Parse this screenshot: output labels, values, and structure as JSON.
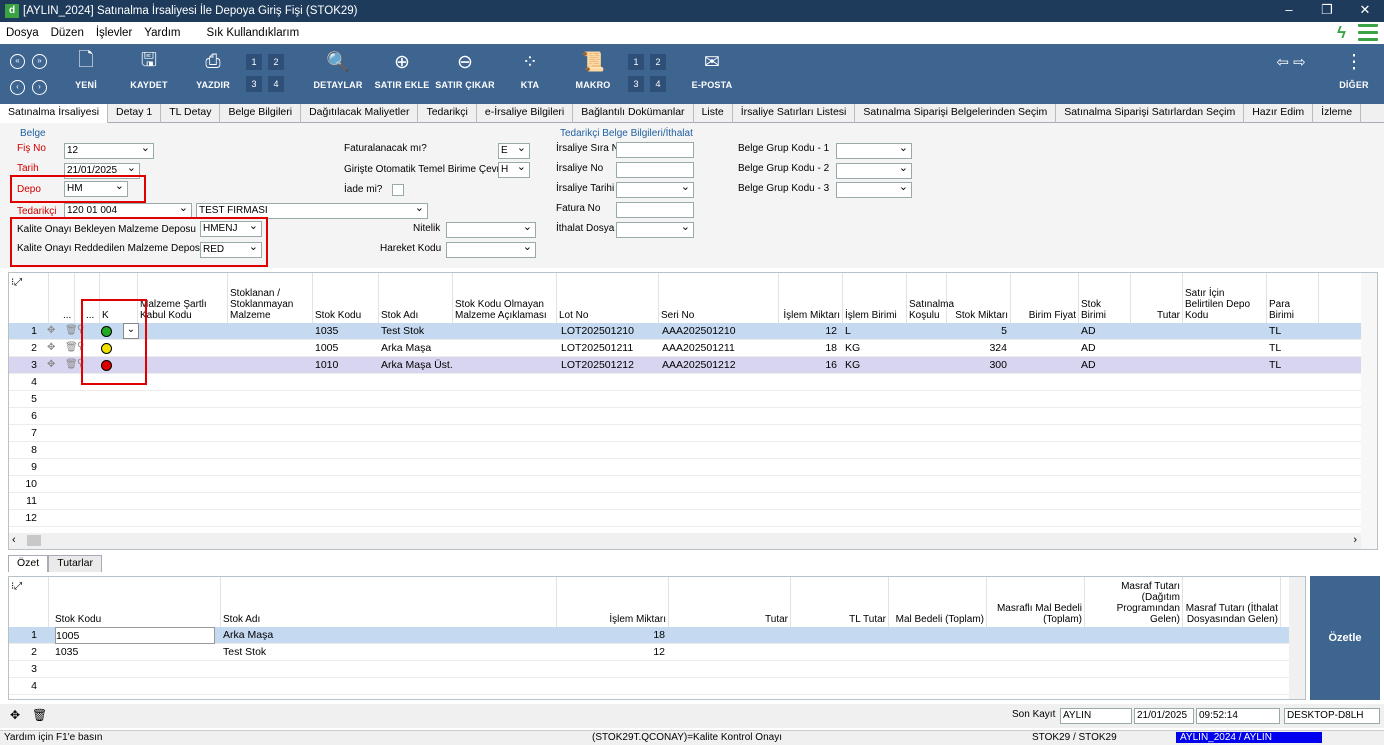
{
  "window": {
    "title": "[AYLIN_2024] Satınalma İrsaliyesi İle Depoya Giriş Fişi (STOK29)",
    "icon": "d"
  },
  "menu": [
    "Dosya",
    "Düzen",
    "İşlevler",
    "Yardım",
    "Sık Kullandıklarım"
  ],
  "toolbar": {
    "yeni": "YENİ",
    "kaydet": "KAYDET",
    "yazdir": "YAZDIR",
    "detaylar": "DETAYLAR",
    "satir_ekle": "SATIR EKLE",
    "satir_cikar": "SATIR ÇIKAR",
    "kta": "KTA",
    "makro": "MAKRO",
    "eposta": "E-POSTA",
    "diger": "DİĞER",
    "pages1": [
      "1",
      "2",
      "3",
      "4"
    ],
    "pages2": [
      "1",
      "2",
      "3",
      "4"
    ]
  },
  "tabs": [
    "Satınalma İrsaliyesi",
    "Detay 1",
    "TL Detay",
    "Belge Bilgileri",
    "Dağıtılacak Maliyetler",
    "Tedarikçi",
    "e-İrsaliye Bilgileri",
    "Bağlantılı Dokümanlar",
    "Liste",
    "İrsaliye Satırları Listesi",
    "Satınalma Siparişi Belgelerinden Seçim",
    "Satınalma Siparişi Satırlardan Seçim",
    "Hazır Edim",
    "İzleme"
  ],
  "form": {
    "belge_group": "Belge",
    "fis_no_label": "Fiş No",
    "fis_no": "12",
    "tarih_label": "Tarih",
    "tarih": "21/01/2025",
    "depo_label": "Depo",
    "depo": "HM",
    "tedarikci_label": "Tedarikçi",
    "tedarikci_kod": "120 01 004",
    "tedarikci_ad": "TEST FIRMASI",
    "kalite_bekleyen_label": "Kalite Onayı Bekleyen Malzeme  Deposu",
    "kalite_bekleyen": "HMENJ",
    "kalite_red_label": "Kalite Onayı Reddedilen Malzeme Deposu",
    "kalite_red": "RED",
    "faturalanacak_label": "Faturalanacak mı?",
    "faturalanacak": "E",
    "giriste_label": "Girişte Otomatik Temel Birime Çevrin",
    "giriste": "H",
    "iade_label": "İade mi?",
    "nitelik_label": "Nitelik",
    "hareket_label": "Hareket Kodu",
    "tedarikci_group": "Tedarikçi Belge Bilgileri/İthalat",
    "irs_sira_label": "İrsaliye Sıra N",
    "irs_no_label": "İrsaliye No",
    "irs_tarih_label": "İrsaliye Tarihi",
    "fatura_no_label": "Fatura No",
    "ithalat_label": "İthalat Dosya",
    "bgk1": "Belge Grup Kodu - 1",
    "bgk2": "Belge Grup Kodu - 2",
    "bgk3": "Belge Grup Kodu - 3"
  },
  "grid": {
    "headers": {
      "k": "K",
      "dots": "...",
      "dots2": "...",
      "malzeme_sartli": "Malzeme Şartlı Kabul Kodu",
      "stoklanan": "Stoklanan / Stoklanmayan Malzeme",
      "stok_kodu": "Stok Kodu",
      "stok_adi": "Stok Adı",
      "stok_kodu_olmayan": "Stok Kodu Olmayan Malzeme Açıklaması",
      "lot_no": "Lot No",
      "seri_no": "Seri No",
      "islem_miktari": "İşlem Miktarı",
      "islem_birimi": "İşlem Birimi",
      "satinalma_kosulu": "Satınalma Koşulu",
      "stok_miktari": "Stok Miktarı",
      "birim_fiyat": "Birim Fiyat",
      "stok_birimi": "Stok Birimi",
      "tutar": "Tutar",
      "satir_icin": "Satır İçin Belirtilen Depo Kodu",
      "para_birimi": "Para Birimi"
    },
    "rows": [
      {
        "n": "1",
        "k_color": "#22aa22",
        "stok_kodu": "1035",
        "stok_adi": "Test Stok",
        "lot": "LOT202501210",
        "seri": "AAA202501210",
        "miktar": "12",
        "birim": "L",
        "stok_miktari": "5",
        "stok_birimi": "AD",
        "para": "TL"
      },
      {
        "n": "2",
        "k_color": "#f0e000",
        "stok_kodu": "1005",
        "stok_adi": "Arka Maşa",
        "lot": "LOT202501211",
        "seri": "AAA202501211",
        "miktar": "18",
        "birim": "KG",
        "stok_miktari": "324",
        "stok_birimi": "AD",
        "para": "TL"
      },
      {
        "n": "3",
        "k_color": "#e00000",
        "stok_kodu": "1010",
        "stok_adi": "Arka Maşa Üst...",
        "lot": "LOT202501212",
        "seri": "AAA202501212",
        "miktar": "16",
        "birim": "KG",
        "stok_miktari": "300",
        "stok_birimi": "AD",
        "para": "TL"
      }
    ],
    "empty_rows": [
      "4",
      "5",
      "6",
      "7",
      "8",
      "9",
      "10",
      "11",
      "12"
    ]
  },
  "bottom_tabs": [
    "Özet",
    "Tutarlar"
  ],
  "summary": {
    "headers": {
      "stok_kodu": "Stok Kodu",
      "stok_adi": "Stok Adı",
      "islem_miktari": "İşlem Miktarı",
      "tutar": "Tutar",
      "tl_tutar": "TL Tutar",
      "mal_bedeli": "Mal Bedeli (Toplam)",
      "masrafli": "Masraflı Mal Bedeli (Toplam)",
      "masraf_dagitim": "Masraf  Tutarı (Dağıtım Programından Gelen)",
      "masraf_ithalat": "Masraf  Tutarı (İthalat Dosyasından Gelen)"
    },
    "rows": [
      {
        "n": "1",
        "stok_kodu": "1005",
        "stok_adi": "Arka Maşa",
        "miktar": "18"
      },
      {
        "n": "2",
        "stok_kodu": "1035",
        "stok_adi": "Test Stok",
        "miktar": "12"
      }
    ],
    "empty_rows": [
      "3",
      "4"
    ],
    "ozetle": "Özetle"
  },
  "footer": {
    "son_kayit_label": "Son Kayıt",
    "user": "AYLIN",
    "date": "21/01/2025",
    "time": "09:52:14",
    "machine": "DESKTOP-D8LH"
  },
  "status": {
    "help": "Yardım için F1'e basın",
    "field": "(STOK29T.QCONAY)=Kalite Kontrol Onayı",
    "form": "STOK29 / STOK29",
    "company": "AYLIN_2024 / AYLIN"
  }
}
